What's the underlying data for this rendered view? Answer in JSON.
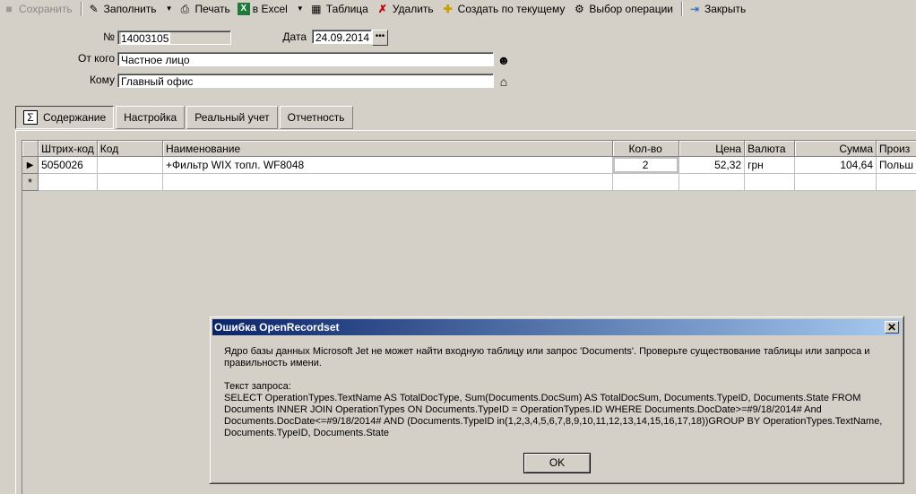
{
  "toolbar": {
    "save": "Сохранить",
    "fill": "Заполнить",
    "print": "Печать",
    "excel": "в Excel",
    "table": "Таблица",
    "delete": "Удалить",
    "create_from_current": "Создать по текущему",
    "choose_operation": "Выбор операции",
    "close": "Закрыть"
  },
  "header": {
    "number_label": "№",
    "number_value": "14003105",
    "date_label": "Дата",
    "date_value": "24.09.2014",
    "from_label": "От кого",
    "from_value": "Частное лицо",
    "to_label": "Кому",
    "to_value": "Главный офис"
  },
  "tabs": [
    "Содержание",
    "Настройка",
    "Реальный учет",
    "Отчетность"
  ],
  "grid": {
    "columns": [
      "Штрих-код",
      "Код",
      "Наименование",
      "Кол-во",
      "Цена",
      "Валюта",
      "Сумма",
      "Произ"
    ],
    "rows": [
      {
        "barcode": "5050026",
        "code": "",
        "name": "+Фильтр WIX топл. WF8048",
        "qty": "2",
        "price": "52,32",
        "currency": "грн",
        "sum": "104,64",
        "manufacturer": "Польш"
      }
    ],
    "new_row_marker": "*"
  },
  "dialog": {
    "title": "Ошибка OpenRecordset",
    "message": "Ядро базы данных Microsoft Jet не может найти входную таблицу или запрос 'Documents'.  Проверьте существование таблицы или запроса и правильность имени.",
    "query_label": "Текст запроса:",
    "query_text": "SELECT OperationTypes.TextName AS TotalDocType, Sum(Documents.DocSum) AS TotalDocSum, Documents.TypeID, Documents.State FROM Documents INNER JOIN OperationTypes ON Documents.TypeID = OperationTypes.ID WHERE Documents.DocDate>=#9/18/2014# And Documents.DocDate<=#9/18/2014# AND (Documents.TypeID in(1,2,3,4,5,6,7,8,9,10,11,12,13,14,15,16,17,18))GROUP BY  OperationTypes.TextName, Documents.TypeID, Documents.State",
    "ok": "OK",
    "close_glyph": "✕"
  }
}
